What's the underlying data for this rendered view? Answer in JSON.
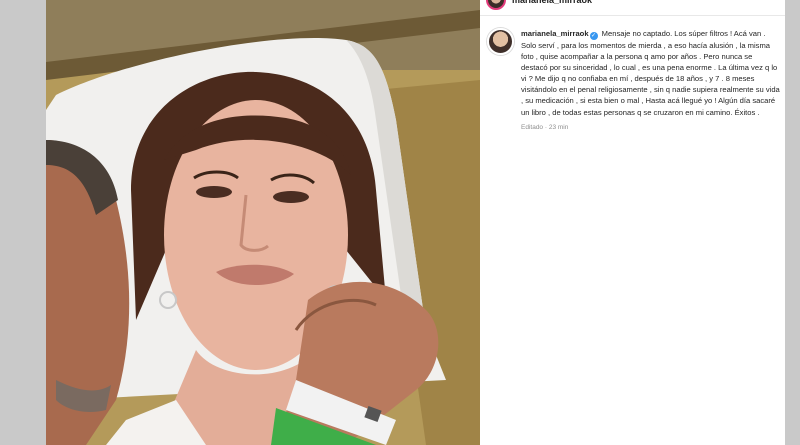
{
  "post": {
    "username": "marianela_mirraok",
    "verified": true,
    "caption": "Mensaje no captado. Los súper filtros ! Acá van . Solo serví , para los momentos de mierda , a eso hacía alusión , la misma foto , quise acompañar a la persona q amo por años . Pero nunca se destacó por su sinceridad , lo cual , es una pena enorme . La última vez q lo vi ? Me dijo q no confiaba en mí , después de 18 años , y 7 . 8 meses visitándolo en el penal religiosamente , sin q nadie supiera realmente su vida , su medicación , si esta bien o mal , Hasta acá llegué yo ! Algún día sacaré un libro , de todas estas personas q se cruzaron en mi camino. Éxitos .",
    "edited_label": "Editado",
    "separator": "·",
    "time_ago": "23 min"
  },
  "colors": {
    "link_blue": "#3897f0",
    "text": "#262626",
    "meta": "#8e8e8e",
    "story_ring": "#e23b7b",
    "wristband_green": "#3fae49"
  },
  "icons": {
    "verified": "verified-badge-icon"
  }
}
